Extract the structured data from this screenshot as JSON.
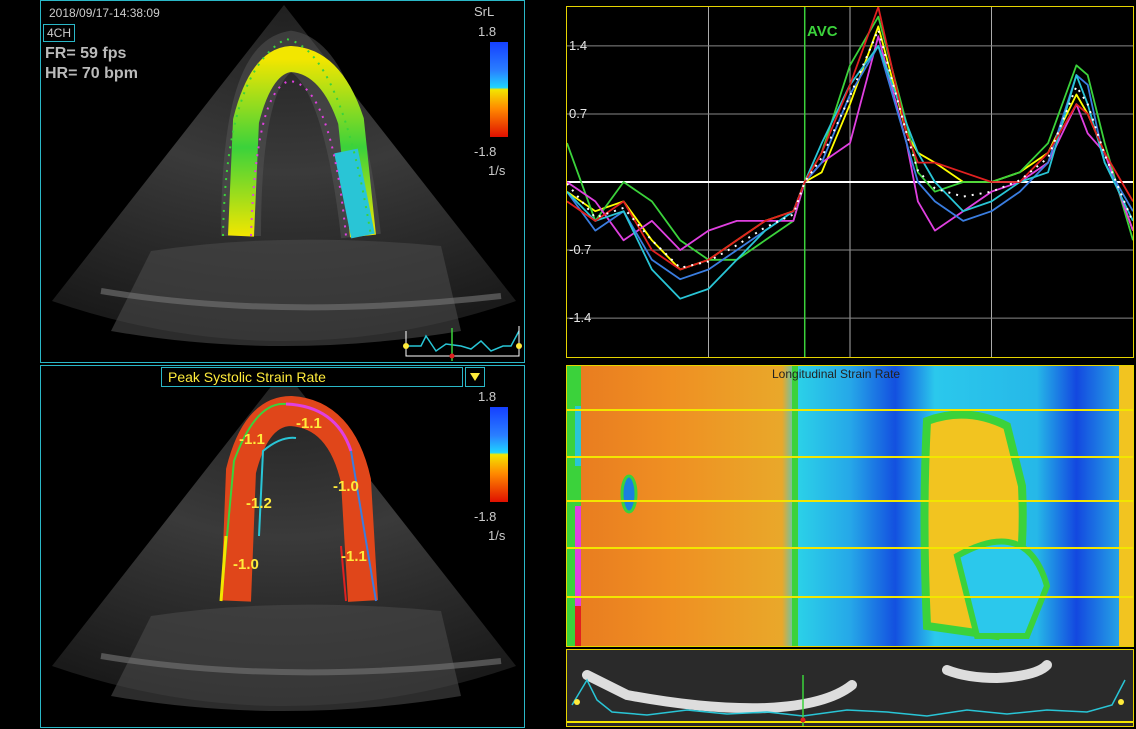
{
  "header": {
    "timestamp": "2018/09/17-14:38:09",
    "view": "4CH",
    "fr": "FR= 59 fps",
    "hr": "HR= 70 bpm"
  },
  "scale_top": {
    "title": "SrL",
    "max": "1.8",
    "min": "-1.8",
    "unit": "1/s"
  },
  "scale_bottom": {
    "max": "1.8",
    "min": "-1.8",
    "unit": "1/s"
  },
  "bottom_panel": {
    "dropdown_label": "Peak Systolic Strain Rate"
  },
  "segments": [
    {
      "label": "-1.1",
      "color": "#3ad13a"
    },
    {
      "label": "-1.1",
      "color": "#e040e0"
    },
    {
      "label": "-1.2",
      "color": "#29c5d6"
    },
    {
      "label": "-1.0",
      "color": "#3a7de0"
    },
    {
      "label": "-1.0",
      "color": "#f2e600"
    },
    {
      "label": "-1.1",
      "color": "#e02020"
    }
  ],
  "curve_panel": {
    "avc_label": "AVC",
    "ticks": [
      "1.4",
      "0.7",
      "-0.7",
      "-1.4"
    ]
  },
  "mmode": {
    "title": "Longitudinal Strain Rate"
  },
  "chart_data": {
    "type": "line",
    "ylim": [
      -1.8,
      1.8
    ],
    "ticks": [
      1.4,
      0.7,
      -0.7,
      -1.4
    ],
    "avc_x": 0.42,
    "x": [
      0,
      0.05,
      0.1,
      0.15,
      0.2,
      0.25,
      0.3,
      0.35,
      0.4,
      0.42,
      0.45,
      0.5,
      0.55,
      0.6,
      0.62,
      0.65,
      0.7,
      0.75,
      0.8,
      0.85,
      0.9,
      0.92,
      0.95,
      1.0
    ],
    "series": [
      {
        "color": "#ffff00",
        "values": [
          -0.1,
          -0.3,
          -0.2,
          -0.6,
          -0.9,
          -0.8,
          -0.6,
          -0.4,
          -0.3,
          0.0,
          0.1,
          0.8,
          1.6,
          0.5,
          0.3,
          0.2,
          0.0,
          0.0,
          0.1,
          0.3,
          0.9,
          0.7,
          0.3,
          -0.5
        ]
      },
      {
        "color": "#3bd23b",
        "values": [
          0.4,
          -0.4,
          0.0,
          -0.2,
          -0.6,
          -0.8,
          -0.8,
          -0.6,
          -0.4,
          0.0,
          0.3,
          1.2,
          1.7,
          0.6,
          0.1,
          -0.1,
          0.0,
          0.0,
          0.1,
          0.4,
          1.2,
          1.1,
          0.4,
          -0.6
        ]
      },
      {
        "color": "#e040e0",
        "values": [
          0.0,
          -0.2,
          -0.6,
          -0.4,
          -0.7,
          -0.5,
          -0.4,
          -0.4,
          -0.4,
          0.0,
          0.2,
          0.4,
          1.5,
          0.4,
          -0.2,
          -0.5,
          -0.3,
          -0.1,
          0.0,
          0.2,
          0.8,
          0.5,
          0.3,
          -0.5
        ]
      },
      {
        "color": "#3a7de0",
        "values": [
          -0.1,
          -0.5,
          -0.3,
          -0.8,
          -1.0,
          -0.9,
          -0.7,
          -0.5,
          -0.3,
          0.0,
          0.2,
          0.9,
          1.4,
          0.4,
          0.0,
          -0.2,
          -0.4,
          -0.3,
          -0.1,
          0.2,
          1.1,
          1.0,
          0.2,
          -0.3
        ]
      },
      {
        "color": "#29c5d6",
        "values": [
          -0.1,
          -0.4,
          -0.3,
          -0.9,
          -1.2,
          -1.1,
          -0.8,
          -0.5,
          -0.3,
          0.0,
          0.4,
          1.0,
          1.4,
          0.6,
          0.3,
          0.0,
          -0.3,
          -0.2,
          0.0,
          0.1,
          1.1,
          0.8,
          0.2,
          -0.4
        ]
      },
      {
        "color": "#e02020",
        "values": [
          -0.2,
          -0.4,
          -0.2,
          -0.7,
          -0.9,
          -0.8,
          -0.6,
          -0.4,
          -0.3,
          0.0,
          0.3,
          1.0,
          1.8,
          0.5,
          0.2,
          0.2,
          0.1,
          0.0,
          0.0,
          0.3,
          0.8,
          0.7,
          0.3,
          -0.2
        ]
      }
    ]
  }
}
